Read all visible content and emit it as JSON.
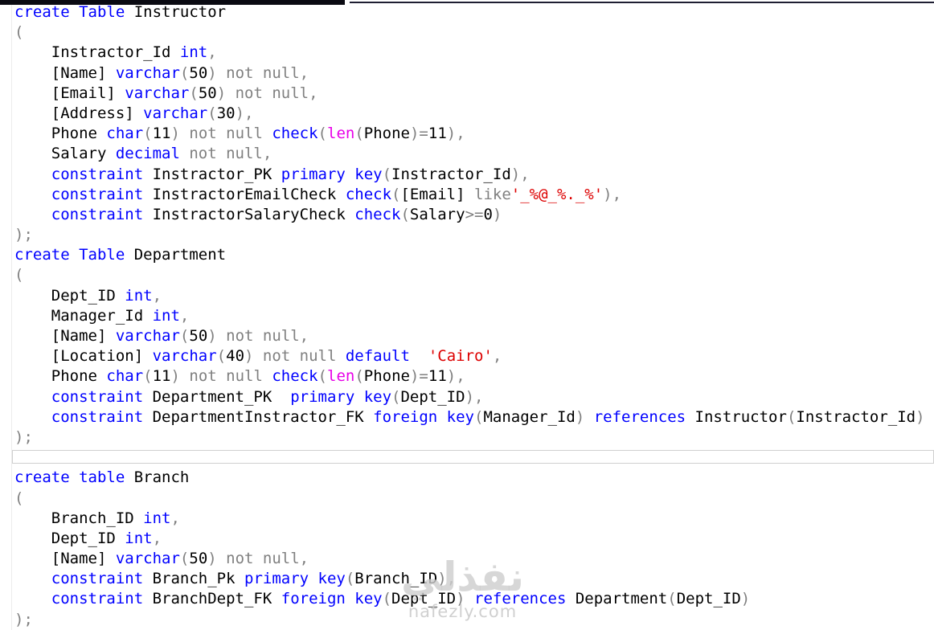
{
  "colors": {
    "keyword": "#0000ff",
    "identifier": "#000000",
    "operator_gray": "#808080",
    "string": "#dd0000",
    "system_function": "#e800e8",
    "topbar_left": "#0a0a12",
    "topbar_right": "#1e1e32",
    "highlight_border": "#cfcfcf",
    "background": "#ffffff"
  },
  "watermark": {
    "arabic": "نفذلي",
    "domain": "nafezly.com"
  },
  "editor": {
    "lines": [
      {
        "segments": [
          [
            "k",
            "create"
          ],
          [
            "i",
            " "
          ],
          [
            "k",
            "Table"
          ],
          [
            "i",
            " Instructor"
          ]
        ]
      },
      {
        "segments": [
          [
            "g",
            "("
          ]
        ]
      },
      {
        "segments": [
          [
            "i",
            "    Instractor_Id "
          ],
          [
            "k",
            "int"
          ],
          [
            "g",
            ","
          ]
        ]
      },
      {
        "segments": [
          [
            "i",
            "    [Name] "
          ],
          [
            "k",
            "varchar"
          ],
          [
            "g",
            "("
          ],
          [
            "i",
            "50"
          ],
          [
            "g",
            ") not null,"
          ]
        ]
      },
      {
        "segments": [
          [
            "i",
            "    [Email] "
          ],
          [
            "k",
            "varchar"
          ],
          [
            "g",
            "("
          ],
          [
            "i",
            "50"
          ],
          [
            "g",
            ") not null,"
          ]
        ]
      },
      {
        "segments": [
          [
            "i",
            "    [Address] "
          ],
          [
            "k",
            "varchar"
          ],
          [
            "g",
            "("
          ],
          [
            "i",
            "30"
          ],
          [
            "g",
            "),"
          ]
        ]
      },
      {
        "segments": [
          [
            "i",
            "    Phone "
          ],
          [
            "k",
            "char"
          ],
          [
            "g",
            "("
          ],
          [
            "i",
            "11"
          ],
          [
            "g",
            ") not null "
          ],
          [
            "k",
            "check"
          ],
          [
            "g",
            "("
          ],
          [
            "m",
            "len"
          ],
          [
            "g",
            "("
          ],
          [
            "i",
            "Phone"
          ],
          [
            "g",
            ")="
          ],
          [
            "i",
            "11"
          ],
          [
            "g",
            "),"
          ]
        ]
      },
      {
        "segments": [
          [
            "i",
            "    Salary "
          ],
          [
            "k",
            "decimal"
          ],
          [
            "g",
            " not null,"
          ]
        ]
      },
      {
        "segments": [
          [
            "i",
            "    "
          ],
          [
            "k",
            "constraint"
          ],
          [
            "i",
            " Instractor_PK "
          ],
          [
            "k",
            "primary key"
          ],
          [
            "g",
            "("
          ],
          [
            "i",
            "Instractor_Id"
          ],
          [
            "g",
            "),"
          ]
        ]
      },
      {
        "segments": [
          [
            "i",
            "    "
          ],
          [
            "k",
            "constraint"
          ],
          [
            "i",
            " InstractorEmailCheck "
          ],
          [
            "k",
            "check"
          ],
          [
            "g",
            "("
          ],
          [
            "i",
            "[Email]"
          ],
          [
            "g",
            " like"
          ],
          [
            "s",
            "'_%@_%._%'"
          ],
          [
            "g",
            "),"
          ]
        ]
      },
      {
        "segments": [
          [
            "i",
            "    "
          ],
          [
            "k",
            "constraint"
          ],
          [
            "i",
            " InstractorSalaryCheck "
          ],
          [
            "k",
            "check"
          ],
          [
            "g",
            "("
          ],
          [
            "i",
            "Salary"
          ],
          [
            "g",
            ">="
          ],
          [
            "i",
            "0"
          ],
          [
            "g",
            ")"
          ]
        ]
      },
      {
        "segments": [
          [
            "g",
            ");"
          ]
        ]
      },
      {
        "segments": [
          [
            "k",
            "create"
          ],
          [
            "i",
            " "
          ],
          [
            "k",
            "Table"
          ],
          [
            "i",
            " Department"
          ]
        ]
      },
      {
        "segments": [
          [
            "g",
            "("
          ]
        ]
      },
      {
        "segments": [
          [
            "i",
            "    Dept_ID "
          ],
          [
            "k",
            "int"
          ],
          [
            "g",
            ","
          ]
        ]
      },
      {
        "segments": [
          [
            "i",
            "    Manager_Id "
          ],
          [
            "k",
            "int"
          ],
          [
            "g",
            ","
          ]
        ]
      },
      {
        "segments": [
          [
            "i",
            "    [Name] "
          ],
          [
            "k",
            "varchar"
          ],
          [
            "g",
            "("
          ],
          [
            "i",
            "50"
          ],
          [
            "g",
            ") not null,"
          ]
        ]
      },
      {
        "segments": [
          [
            "i",
            "    [Location] "
          ],
          [
            "k",
            "varchar"
          ],
          [
            "g",
            "("
          ],
          [
            "i",
            "40"
          ],
          [
            "g",
            ") not null "
          ],
          [
            "k",
            "default"
          ],
          [
            "i",
            "  "
          ],
          [
            "s",
            "'Cairo'"
          ],
          [
            "g",
            ","
          ]
        ]
      },
      {
        "segments": [
          [
            "i",
            "    Phone "
          ],
          [
            "k",
            "char"
          ],
          [
            "g",
            "("
          ],
          [
            "i",
            "11"
          ],
          [
            "g",
            ") not null "
          ],
          [
            "k",
            "check"
          ],
          [
            "g",
            "("
          ],
          [
            "m",
            "len"
          ],
          [
            "g",
            "("
          ],
          [
            "i",
            "Phone"
          ],
          [
            "g",
            ")="
          ],
          [
            "i",
            "11"
          ],
          [
            "g",
            "),"
          ]
        ]
      },
      {
        "segments": [
          [
            "i",
            "    "
          ],
          [
            "k",
            "constraint"
          ],
          [
            "i",
            " Department_PK  "
          ],
          [
            "k",
            "primary key"
          ],
          [
            "g",
            "("
          ],
          [
            "i",
            "Dept_ID"
          ],
          [
            "g",
            "),"
          ]
        ]
      },
      {
        "segments": [
          [
            "i",
            "    "
          ],
          [
            "k",
            "constraint"
          ],
          [
            "i",
            " DepartmentInstractor_FK "
          ],
          [
            "k",
            "foreign key"
          ],
          [
            "g",
            "("
          ],
          [
            "i",
            "Manager_Id"
          ],
          [
            "g",
            ") "
          ],
          [
            "k",
            "references"
          ],
          [
            "i",
            " Instructor"
          ],
          [
            "g",
            "("
          ],
          [
            "i",
            "Instractor_Id"
          ],
          [
            "g",
            ")"
          ]
        ]
      },
      {
        "segments": [
          [
            "g",
            ");"
          ]
        ]
      },
      {
        "highlight": true,
        "segments": []
      },
      {
        "segments": [
          [
            "k",
            "create table"
          ],
          [
            "i",
            " Branch"
          ]
        ]
      },
      {
        "segments": [
          [
            "g",
            "("
          ]
        ]
      },
      {
        "segments": [
          [
            "i",
            "    Branch_ID "
          ],
          [
            "k",
            "int"
          ],
          [
            "g",
            ","
          ]
        ]
      },
      {
        "segments": [
          [
            "i",
            "    Dept_ID "
          ],
          [
            "k",
            "int"
          ],
          [
            "g",
            ","
          ]
        ]
      },
      {
        "segments": [
          [
            "i",
            "    [Name] "
          ],
          [
            "k",
            "varchar"
          ],
          [
            "g",
            "("
          ],
          [
            "i",
            "50"
          ],
          [
            "g",
            ") not null,"
          ]
        ]
      },
      {
        "segments": [
          [
            "i",
            "    "
          ],
          [
            "k",
            "constraint"
          ],
          [
            "i",
            " Branch_Pk "
          ],
          [
            "k",
            "primary key"
          ],
          [
            "g",
            "("
          ],
          [
            "i",
            "Branch_ID"
          ],
          [
            "g",
            "),"
          ]
        ]
      },
      {
        "segments": [
          [
            "i",
            "    "
          ],
          [
            "k",
            "constraint"
          ],
          [
            "i",
            " BranchDept_FK "
          ],
          [
            "k",
            "foreign key"
          ],
          [
            "g",
            "("
          ],
          [
            "i",
            "Dept_ID"
          ],
          [
            "g",
            ") "
          ],
          [
            "k",
            "references"
          ],
          [
            "i",
            " Department"
          ],
          [
            "g",
            "("
          ],
          [
            "i",
            "Dept_ID"
          ],
          [
            "g",
            ")"
          ]
        ]
      },
      {
        "segments": [
          [
            "g",
            ");"
          ]
        ]
      }
    ]
  }
}
